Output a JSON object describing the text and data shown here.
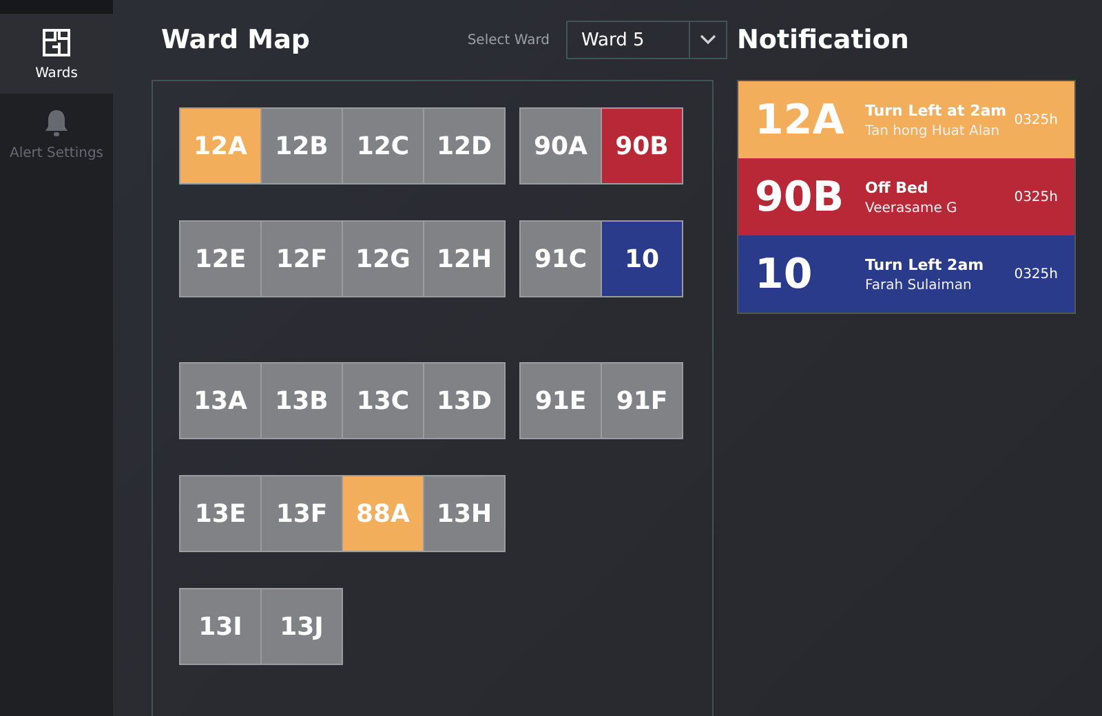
{
  "sidebar": {
    "items": [
      {
        "label": "Wards",
        "selected": true
      },
      {
        "label": "Alert Settings",
        "selected": false
      }
    ]
  },
  "ward_map": {
    "title": "Ward Map",
    "select_label": "Select Ward",
    "select_value": "Ward 5",
    "rows": [
      {
        "groups": [
          {
            "beds": [
              {
                "label": "12A",
                "color": "#f2ae5a"
              },
              {
                "label": "12B",
                "color": "#808285"
              },
              {
                "label": "12C",
                "color": "#808285"
              },
              {
                "label": "12D",
                "color": "#808285"
              }
            ]
          },
          {
            "beds": [
              {
                "label": "90A",
                "color": "#808285"
              },
              {
                "label": "90B",
                "color": "#b92837"
              }
            ]
          }
        ]
      },
      {
        "groups": [
          {
            "beds": [
              {
                "label": "12E",
                "color": "#808285"
              },
              {
                "label": "12F",
                "color": "#808285"
              },
              {
                "label": "12G",
                "color": "#808285"
              },
              {
                "label": "12H",
                "color": "#808285"
              }
            ]
          },
          {
            "beds": [
              {
                "label": "91C",
                "color": "#808285"
              },
              {
                "label": "10",
                "color": "#2a3b8c"
              }
            ]
          }
        ]
      },
      {
        "groups": [
          {
            "beds": [
              {
                "label": "13A",
                "color": "#808285"
              },
              {
                "label": "13B",
                "color": "#808285"
              },
              {
                "label": "13C",
                "color": "#808285"
              },
              {
                "label": "13D",
                "color": "#808285"
              }
            ]
          },
          {
            "beds": [
              {
                "label": "91E",
                "color": "#808285"
              },
              {
                "label": "91F",
                "color": "#808285"
              }
            ]
          }
        ]
      },
      {
        "groups": [
          {
            "beds": [
              {
                "label": "13E",
                "color": "#808285"
              },
              {
                "label": "13F",
                "color": "#808285"
              },
              {
                "label": "88A",
                "color": "#f2ae5a"
              },
              {
                "label": "13H",
                "color": "#808285"
              }
            ]
          }
        ]
      },
      {
        "groups": [
          {
            "beds": [
              {
                "label": "13I",
                "color": "#808285"
              },
              {
                "label": "13J",
                "color": "#808285"
              }
            ]
          }
        ]
      }
    ]
  },
  "notifications": {
    "title": "Notification",
    "items": [
      {
        "bed": "12A",
        "alert": "Turn Left at 2am",
        "patient": "Tan hong Huat Alan",
        "time": "0325h",
        "color": "#f2ae5a"
      },
      {
        "bed": "90B",
        "alert": "Off Bed",
        "patient": "Veerasame G",
        "time": "0325h",
        "color": "#b92837"
      },
      {
        "bed": "10",
        "alert": "Turn Left 2am",
        "patient": "Farah Sulaiman",
        "time": "0325h",
        "color": "#2a3b8c"
      }
    ]
  }
}
